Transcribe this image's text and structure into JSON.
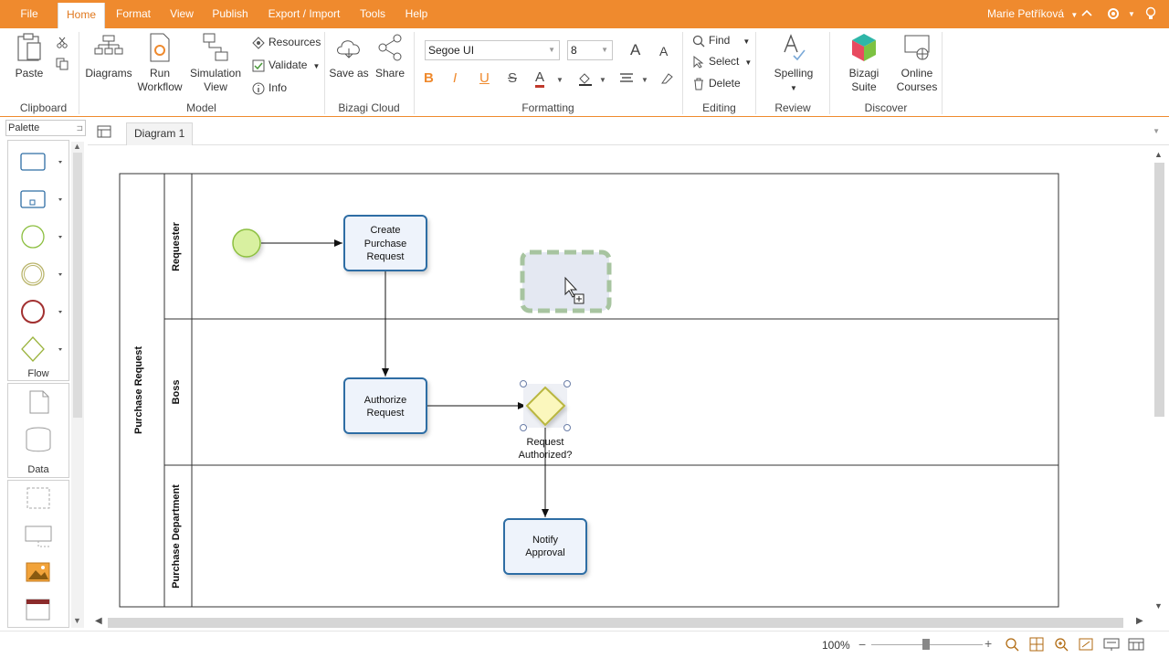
{
  "menu": {
    "tabs": [
      {
        "label": "File"
      },
      {
        "label": "Home"
      },
      {
        "label": "Format"
      },
      {
        "label": "View"
      },
      {
        "label": "Publish"
      },
      {
        "label": "Export / Import"
      },
      {
        "label": "Tools"
      },
      {
        "label": "Help"
      }
    ],
    "user": "Marie Petříková"
  },
  "ribbon": {
    "clipboard": {
      "paste": "Paste",
      "label": "Clipboard"
    },
    "model": {
      "diagrams": "Diagrams",
      "run_workflow_1": "Run",
      "run_workflow_2": "Workflow",
      "simulation_1": "Simulation",
      "simulation_2": "View",
      "resources": "Resources",
      "validate": "Validate",
      "info": "Info",
      "label": "Model"
    },
    "cloud": {
      "save_as": "Save as",
      "share": "Share",
      "label": "Bizagi Cloud"
    },
    "formatting": {
      "font_family": "Segoe UI",
      "font_size": "8",
      "label": "Formatting",
      "bold": "B",
      "italic": "I",
      "underline": "U",
      "strike": "S",
      "font_color": "A"
    },
    "editing": {
      "find": "Find",
      "select": "Select",
      "delete": "Delete",
      "label": "Editing"
    },
    "review": {
      "spelling": "Spelling",
      "label": "Review"
    },
    "discover": {
      "bizagi_suite": "Bizagi Suite",
      "online_courses_1": "Online",
      "online_courses_2": "Courses",
      "label": "Discover"
    }
  },
  "palette": {
    "search_value": "Palette",
    "sections": {
      "flow": "Flow",
      "data": "Data"
    }
  },
  "diagram_tab": "Diagram 1",
  "diagram": {
    "pool": "Purchase Request",
    "lanes": [
      "Requester",
      "Boss",
      "Purchase Department"
    ],
    "tasks": {
      "create_1": "Create",
      "create_2": "Purchase",
      "create_3": "Request",
      "authorize_1": "Authorize",
      "authorize_2": "Request",
      "notify_1": "Notify",
      "notify_2": "Approval"
    },
    "gateway_1": "Request",
    "gateway_2": "Authorized?"
  },
  "status": {
    "zoom": "100%"
  },
  "colors": {
    "accent": "#ef8a2e",
    "task_border": "#2e6da4",
    "task_fill": "#eef3fb",
    "start_fill": "#d8f0a0",
    "start_stroke": "#8cbf3f",
    "gateway_fill": "#fbf7bd",
    "gateway_stroke": "#b9b640"
  }
}
